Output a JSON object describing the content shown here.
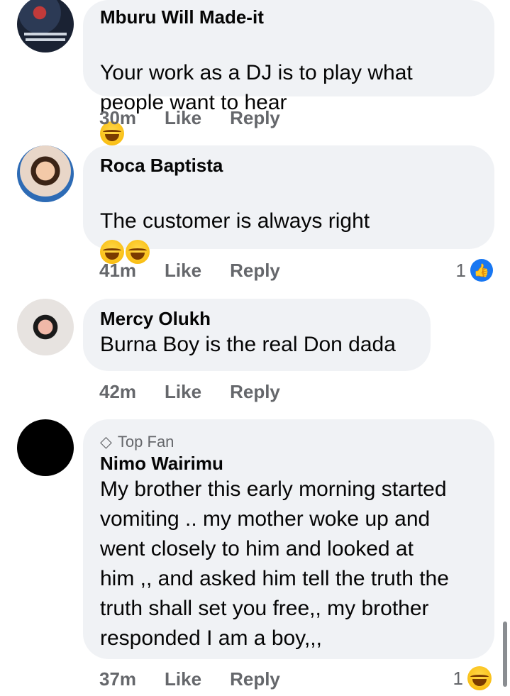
{
  "comments": [
    {
      "author": "Mburu Will Made-it",
      "text": "Your work as a DJ is to play what\npeople want to hear",
      "time": "30m",
      "like_label": "Like",
      "reply_label": "Reply"
    },
    {
      "author": "Roca Baptista",
      "text": "The customer is always right",
      "time": "41m",
      "like_label": "Like",
      "reply_label": "Reply",
      "reaction_count": "1"
    },
    {
      "author": "Mercy Olukh",
      "text": "Burna Boy is the real Don dada",
      "time": "42m",
      "like_label": "Like",
      "reply_label": "Reply"
    },
    {
      "badge": "Top Fan",
      "author": "Nimo Wairimu",
      "text": "My brother this early morning started\nvomiting .. my mother woke up and\nwent closely to him and looked at\nhim ,, and asked him tell the truth the\ntruth shall set you free,, my brother\nresponded I am a boy,,,",
      "time": "37m",
      "like_label": "Like",
      "reply_label": "Reply",
      "reaction_count": "1"
    }
  ],
  "colors": {
    "bubble": "#f0f2f5",
    "meta_text": "#65676b",
    "like_blue": "#1877f2"
  },
  "icons": [
    "grinning-sweat-emoji",
    "tears-of-joy-emoji",
    "like-icon",
    "diamond-icon",
    "laughing-emoji"
  ]
}
